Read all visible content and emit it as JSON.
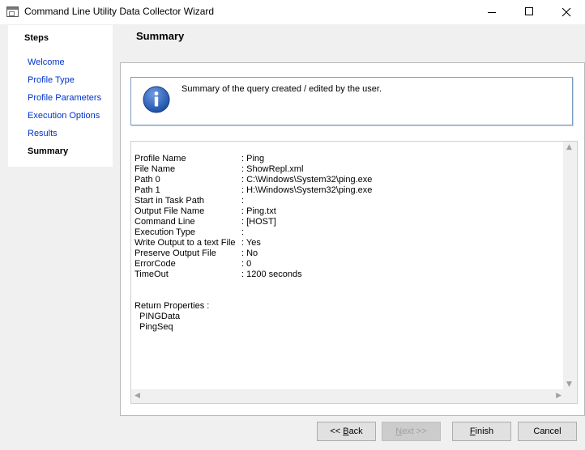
{
  "window": {
    "title": "Command Line Utility Data Collector Wizard"
  },
  "steps": {
    "header": "Steps",
    "items": [
      {
        "label": "Welcome",
        "active": false
      },
      {
        "label": "Profile Type",
        "active": false
      },
      {
        "label": "Profile Parameters",
        "active": false
      },
      {
        "label": "Execution Options",
        "active": false
      },
      {
        "label": "Results",
        "active": false
      },
      {
        "label": "Summary",
        "active": true
      }
    ]
  },
  "header": {
    "title": "Summary"
  },
  "info": {
    "text": "Summary of the query created / edited by the user.",
    "icon": "info-icon"
  },
  "summary": {
    "rows": [
      {
        "key": "Profile Name",
        "value": ": Ping"
      },
      {
        "key": "File Name",
        "value": ": ShowRepl.xml"
      },
      {
        "key": "Path 0",
        "value": ": C:\\Windows\\System32\\ping.exe"
      },
      {
        "key": "Path 1",
        "value": ": H:\\Windows\\System32\\ping.exe"
      },
      {
        "key": "Start in Task Path",
        "value": ":"
      },
      {
        "key": "Output File Name",
        "value": ": Ping.txt"
      },
      {
        "key": "Command Line",
        "value": " : [HOST]"
      },
      {
        "key": "Execution Type",
        "value": ":"
      },
      {
        "key": "Write Output to a text File",
        "value": ": Yes"
      },
      {
        "key": "Preserve Output File",
        "value": ": No"
      },
      {
        "key": "ErrorCode",
        "value": ": 0"
      },
      {
        "key": "TimeOut",
        "value": ": 1200 seconds"
      }
    ],
    "return_title": "Return Properties :",
    "return_items": [
      "PINGData",
      "PingSeq"
    ]
  },
  "buttons": {
    "back_prefix": "<< ",
    "back_underline": "B",
    "back_rest": "ack",
    "next_underline": "N",
    "next_rest": "ext >>",
    "finish_underline": "F",
    "finish_rest": "inish",
    "cancel": "Cancel"
  }
}
